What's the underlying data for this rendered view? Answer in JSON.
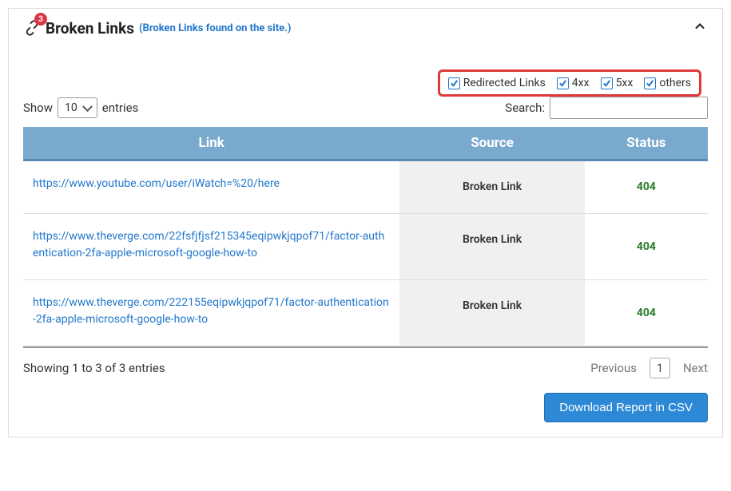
{
  "header": {
    "title": "Broken Links",
    "subtitle": "(Broken Links found on the site.)",
    "badge_count": "3"
  },
  "filters": {
    "redirected": {
      "label": "Redirected Links",
      "checked": true
    },
    "status_4xx": {
      "label": "4xx",
      "checked": true
    },
    "status_5xx": {
      "label": "5xx",
      "checked": true
    },
    "others": {
      "label": "others",
      "checked": true
    }
  },
  "controls": {
    "show_label": "Show",
    "entries_label": "entries",
    "page_size": "10",
    "search_label": "Search:",
    "search_value": ""
  },
  "table": {
    "headers": {
      "link": "Link",
      "source": "Source",
      "status": "Status"
    },
    "rows": [
      {
        "link": "https://www.youtube.com/user/iWatch=%20/here",
        "source": "Broken Link",
        "status": "404"
      },
      {
        "link": "https://www.theverge.com/22fsfjfjsf215345eqipwkjqpof71/factor-authentication-2fa-apple-microsoft-google-how-to",
        "source": "Broken Link",
        "status": "404"
      },
      {
        "link": "https://www.theverge.com/222155eqipwkjqpof71/factor-authentication-2fa-apple-microsoft-google-how-to",
        "source": "Broken Link",
        "status": "404"
      }
    ]
  },
  "footer": {
    "info": "Showing 1 to 3 of 3 entries",
    "prev_label": "Previous",
    "next_label": "Next",
    "current_page": "1"
  },
  "actions": {
    "download_label": "Download Report in CSV"
  }
}
